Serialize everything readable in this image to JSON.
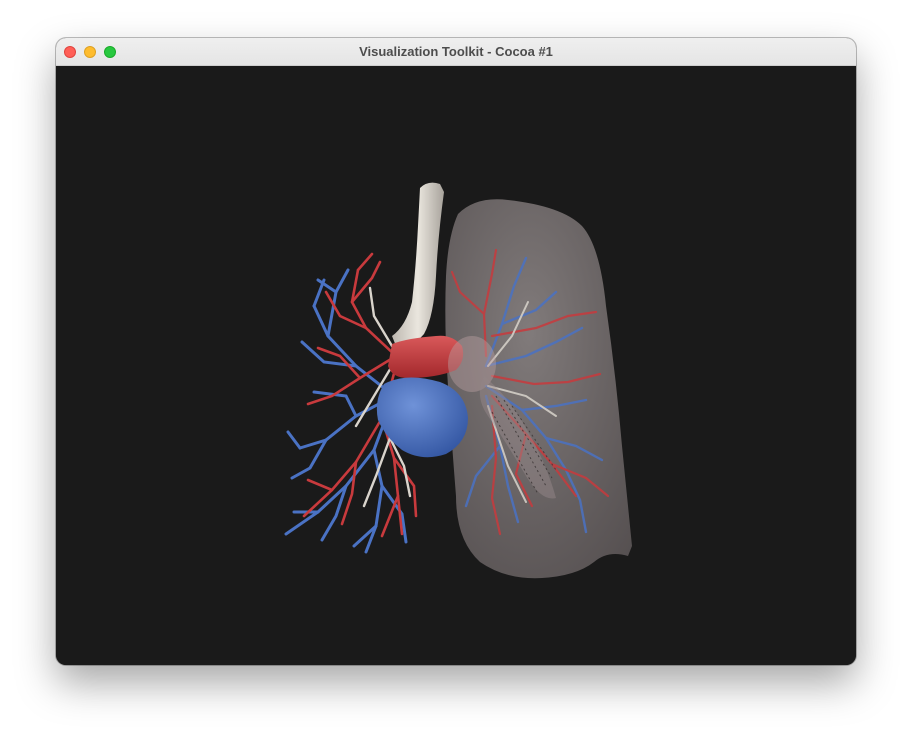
{
  "window": {
    "title": "Visualization Toolkit - Cocoa #1",
    "controls": {
      "close": "close-icon",
      "minimize": "minimize-icon",
      "zoom": "zoom-icon"
    }
  },
  "scene": {
    "background_color": "#1a1a1a",
    "colors": {
      "artery": "#c83a3d",
      "vein": "#4a72c4",
      "airway": "#d9d4cc",
      "lung_surface": "#8a8283"
    }
  }
}
